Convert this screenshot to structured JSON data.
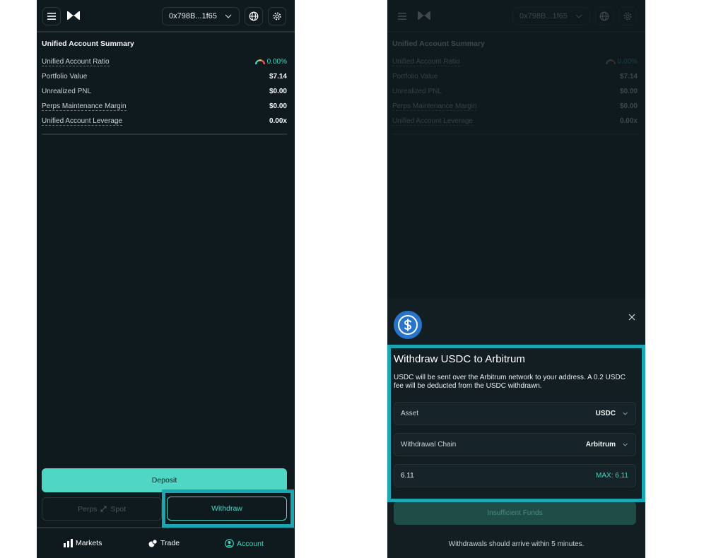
{
  "header": {
    "address": "0x798B...1f65"
  },
  "summary": {
    "title": "Unified Account Summary",
    "rows": [
      {
        "label": "Unified Account Ratio",
        "value": "0.00%"
      },
      {
        "label": "Portfolio Value",
        "value": "$7.14"
      },
      {
        "label": "Unrealized PNL",
        "value": "$0.00"
      },
      {
        "label": "Perps Maintenance Margin",
        "value": "$0.00"
      },
      {
        "label": "Unified Account Leverage",
        "value": "0.00x"
      }
    ]
  },
  "actions": {
    "deposit_label": "Deposit",
    "perps_label": "Perps",
    "spot_label": "Spot",
    "withdraw_label": "Withdraw"
  },
  "nav": {
    "markets": "Markets",
    "trade": "Trade",
    "account": "Account"
  },
  "withdraw_modal": {
    "title": "Withdraw USDC to Arbitrum",
    "description": "USDC will be sent over the Arbitrum network to your address. A 0.2 USDC fee will be deducted from the USDC withdrawn.",
    "asset_label": "Asset",
    "asset_value": "USDC",
    "chain_label": "Withdrawal Chain",
    "chain_value": "Arbitrum",
    "amount_value": "6.11",
    "max_label": "MAX: 6.11",
    "submit_label": "Insufficient Funds",
    "footer_note": "Withdrawals should arrive within 5 minutes."
  },
  "colors": {
    "background": "#0f1a1f",
    "accent": "#4fd6c4",
    "highlight": "#1aa6b3",
    "usdc_blue": "#2775ca"
  }
}
